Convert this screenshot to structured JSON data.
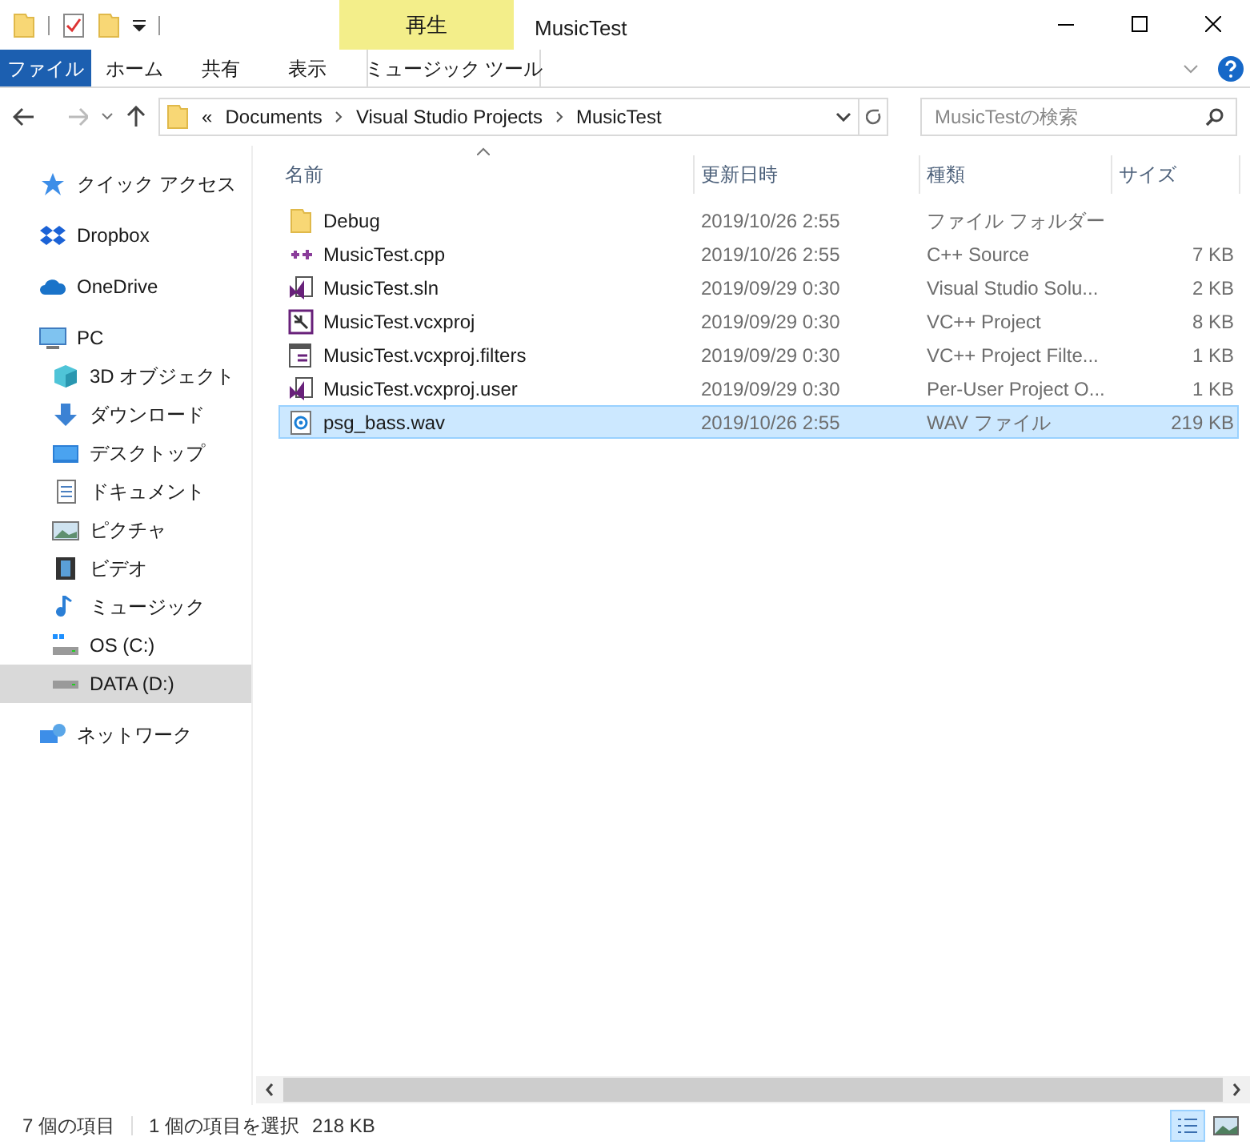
{
  "window": {
    "title": "MusicTest"
  },
  "contextual_tab": {
    "label": "再生"
  },
  "ribbon_tabs": [
    {
      "label": "ファイル",
      "kind": "file",
      "selected": false
    },
    {
      "label": "ホーム",
      "kind": "tab",
      "selected": false
    },
    {
      "label": "共有",
      "kind": "tab",
      "selected": false
    },
    {
      "label": "表示",
      "kind": "tab",
      "selected": false
    },
    {
      "label": "ミュージック ツール",
      "kind": "contextual",
      "selected": false
    }
  ],
  "address": {
    "prefix": "«",
    "crumbs": [
      "Documents",
      "Visual Studio Projects",
      "MusicTest"
    ]
  },
  "search": {
    "placeholder": "MusicTestの検索"
  },
  "sidebar": {
    "items": [
      {
        "label": "クイック アクセス",
        "selected": false
      },
      {
        "label": "Dropbox",
        "selected": false
      },
      {
        "label": "OneDrive",
        "selected": false
      },
      {
        "label": "PC",
        "selected": false,
        "children": [
          {
            "label": "3D オブジェクト",
            "selected": false
          },
          {
            "label": "ダウンロード",
            "selected": false
          },
          {
            "label": "デスクトップ",
            "selected": false
          },
          {
            "label": "ドキュメント",
            "selected": false
          },
          {
            "label": "ピクチャ",
            "selected": false
          },
          {
            "label": "ビデオ",
            "selected": false
          },
          {
            "label": "ミュージック",
            "selected": false
          },
          {
            "label": "OS (C:)",
            "selected": false
          },
          {
            "label": "DATA (D:)",
            "selected": true
          }
        ]
      },
      {
        "label": "ネットワーク",
        "selected": false
      }
    ]
  },
  "table": {
    "columns": [
      "名前",
      "更新日時",
      "種類",
      "サイズ"
    ],
    "rows": [
      {
        "name": "Debug",
        "date": "2019/10/26 2:55",
        "type": "ファイル フォルダー",
        "selected": false
      },
      {
        "name": "MusicTest.cpp",
        "date": "2019/10/26 2:55",
        "type": "C++ Source",
        "size": "7 KB",
        "selected": false
      },
      {
        "name": "MusicTest.sln",
        "date": "2019/09/29 0:30",
        "type": "Visual Studio Solu...",
        "size": "2 KB",
        "selected": false
      },
      {
        "name": "MusicTest.vcxproj",
        "date": "2019/09/29 0:30",
        "type": "VC++ Project",
        "size": "8 KB",
        "selected": false
      },
      {
        "name": "MusicTest.vcxproj.filters",
        "date": "2019/09/29 0:30",
        "type": "VC++ Project Filte...",
        "size": "1 KB",
        "selected": false
      },
      {
        "name": "MusicTest.vcxproj.user",
        "date": "2019/09/29 0:30",
        "type": "Per-User Project O...",
        "size": "1 KB",
        "selected": false
      },
      {
        "name": "psg_bass.wav",
        "date": "2019/10/26 2:55",
        "type": "WAV ファイル",
        "size": "219 KB",
        "selected": true
      }
    ]
  },
  "status_bar": {
    "count": "7 個の項目",
    "selection": "1 個の項目を選択",
    "selection_size": "218 KB"
  },
  "view_buttons": [
    {
      "kind": "details",
      "selected": true
    },
    {
      "kind": "thumbnails",
      "selected": false
    }
  ]
}
